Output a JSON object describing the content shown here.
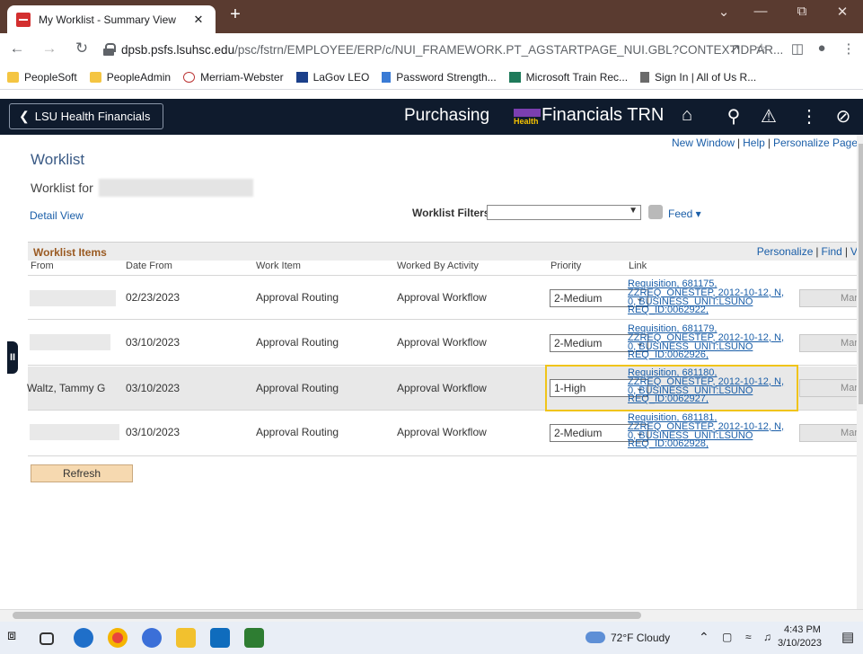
{
  "browser": {
    "tab_title": "My Worklist - Summary View",
    "tab_close": "✕",
    "new_tab": "+",
    "url_host": "dpsb.psfs.lsuhsc.edu",
    "url_path": "/psc/fstrn/EMPLOYEE/ERP/c/NUI_FRAMEWORK.PT_AGSTARTPAGE_NUI.GBL?CONTEXTIDPAR...",
    "bookmarks": [
      "PeopleSoft",
      "PeopleAdmin",
      "Merriam-Webster",
      "LaGov LEO",
      "Password Strength...",
      "Microsoft Train Rec...",
      "Sign In | All of Us R..."
    ]
  },
  "header": {
    "back_label": "LSU Health Financials",
    "module": "Purchasing",
    "logo_text": "Health",
    "app_title": "Financials TRN"
  },
  "page": {
    "links": [
      "New Window",
      "Help",
      "Personalize Page"
    ],
    "title": "Worklist",
    "worklist_for": "Worklist for",
    "detail_view": "Detail View",
    "filters_label": "Worklist Filters",
    "feed_label": "Feed ▾"
  },
  "grid": {
    "title": "Worklist Items",
    "links": [
      "Personalize",
      "Find",
      "V"
    ],
    "columns": [
      "From",
      "Date From",
      "Work Item",
      "Worked By Activity",
      "Priority",
      "Link"
    ],
    "rows": [
      {
        "from": "",
        "date": "02/23/2023",
        "work_item": "Approval Routing",
        "activity": "Approval Workflow",
        "priority": "2-Medium",
        "link": [
          "Requisition, 681175,",
          "ZZREQ_ONESTEP, 2012-10-12, N,",
          "0, BUSINESS_UNIT:LSUNO",
          "REQ_ID:0062922,"
        ],
        "button": "Mar"
      },
      {
        "from": "",
        "date": "03/10/2023",
        "work_item": "Approval Routing",
        "activity": "Approval Workflow",
        "priority": "2-Medium",
        "link": [
          "Requisition, 681179,",
          "ZZREQ_ONESTEP, 2012-10-12, N,",
          "0, BUSINESS_UNIT:LSUNO",
          "REQ_ID:0062926,"
        ],
        "button": "Mar"
      },
      {
        "from": "Waltz, Tammy G",
        "date": "03/10/2023",
        "work_item": "Approval Routing",
        "activity": "Approval Workflow",
        "priority": "1-High",
        "link": [
          "Requisition, 681180,",
          "ZZREQ_ONESTEP, 2012-10-12, N,",
          "0, BUSINESS_UNIT:LSUNO",
          "REQ_ID:0062927,"
        ],
        "button": "Mar"
      },
      {
        "from": "",
        "date": "03/10/2023",
        "work_item": "Approval Routing",
        "activity": "Approval Workflow",
        "priority": "2-Medium",
        "link": [
          "Requisition, 681181,",
          "ZZREQ_ONESTEP, 2012-10-12, N,",
          "0, BUSINESS_UNIT:LSUNO",
          "REQ_ID:0062928,"
        ],
        "button": "Mar"
      }
    ],
    "refresh_label": "Refresh"
  },
  "taskbar": {
    "weather": "72°F  Cloudy",
    "time": "4:43 PM",
    "date": "3/10/2023"
  },
  "icons": {
    "back": "back-arrow-icon",
    "forward": "forward-arrow-icon",
    "reload": "reload-icon",
    "home": "home-icon",
    "search": "search-icon",
    "bell": "bell-icon",
    "menu": "kebab-menu-icon",
    "nav": "compass-icon"
  }
}
